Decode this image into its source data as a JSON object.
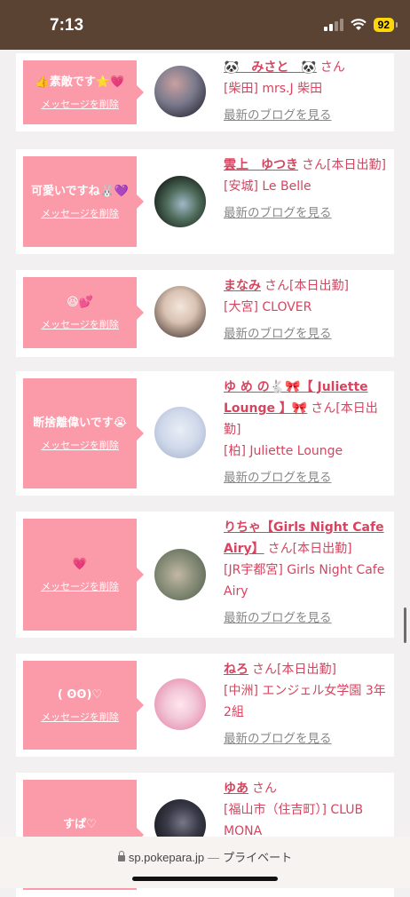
{
  "status": {
    "time": "7:13",
    "battery": "92"
  },
  "delete_label": "メッセージを削除",
  "blog_label": "最新のブログを見る",
  "cards": [
    {
      "msg": "👍素敵です⭐💗",
      "name": "🐼　みさと　🐼",
      "honor": "さん",
      "shop": "[柴田] mrs.J 柴田",
      "avatar_colors": [
        "#3b3a4a",
        "#7a7a8c",
        "#c9a0a0"
      ]
    },
    {
      "msg": "可愛いですね🐰💜",
      "name": "雲上　ゆつき",
      "honor": "さん[本日出勤]",
      "shop": "[安城] Le Belle",
      "avatar_colors": [
        "#1f2a22",
        "#4e6b5a",
        "#a0b8c8"
      ]
    },
    {
      "msg": "😆💕",
      "name": "まなみ",
      "honor": "さん[本日出勤]",
      "shop": "[大宮] CLOVER",
      "avatar_colors": [
        "#6d5a52",
        "#d9c2b2",
        "#f3e6dc"
      ]
    },
    {
      "msg": "断捨離偉いです😭",
      "name": "ゆ め の🐇🎀【 Juliette Lounge 】🎀",
      "honor": "さん[本日出勤]",
      "shop": "[柏] Juliette Lounge",
      "avatar_colors": [
        "#e9eef6",
        "#cfd8ea",
        "#a8b6cf"
      ]
    },
    {
      "msg": "💗",
      "name": "りちゃ【Girls Night Cafe Airy】",
      "honor": "さん[本日出勤]",
      "shop": "[JR宇都宮] Girls Night Cafe Airy",
      "avatar_colors": [
        "#8a8f7a",
        "#c3b8a4",
        "#5d6a58"
      ]
    },
    {
      "msg": "( ʘʘ)♡",
      "name": "ねろ",
      "honor": "さん[本日出勤]",
      "shop": "[中洲] エンジェル女学園 3年2組",
      "avatar_colors": [
        "#f2c8d8",
        "#e78fb0",
        "#ffe5ee"
      ]
    },
    {
      "msg": "すぱ♡",
      "name": "ゆあ",
      "honor": "さん",
      "shop": "[福山市（住吉町）] CLUB MONA",
      "avatar_colors": [
        "#1b1b24",
        "#3a3a48",
        "#777788"
      ]
    }
  ],
  "url_bar": {
    "domain": "sp.pokepara.jp",
    "separator": "—",
    "mode": "プライベート"
  }
}
